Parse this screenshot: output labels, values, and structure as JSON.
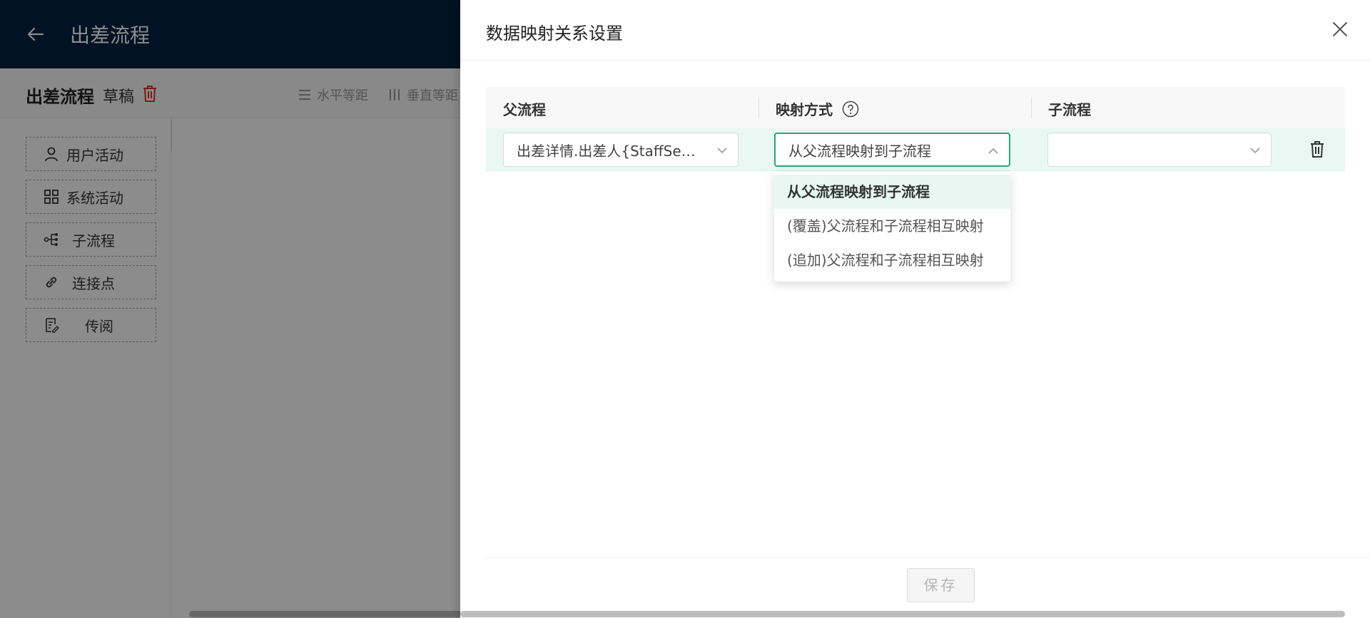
{
  "header": {
    "title": "出差流程",
    "back_icon": "arrow-left-icon"
  },
  "toolbar": {
    "flow_name": "出差流程",
    "status": "草稿",
    "delete_icon": "trash-icon",
    "delete_color": "#e0352b",
    "buttons": [
      {
        "label": "水平等距",
        "icon": "horizontal-distribute-icon"
      },
      {
        "label": "垂直等距",
        "icon": "vertical-distribute-icon"
      }
    ]
  },
  "palette": {
    "items": [
      {
        "label": "用户活动",
        "icon": "user-icon"
      },
      {
        "label": "系统活动",
        "icon": "grid-icon"
      },
      {
        "label": "子流程",
        "icon": "subprocess-icon"
      },
      {
        "label": "连接点",
        "icon": "link-icon"
      },
      {
        "label": "传阅",
        "icon": "document-icon"
      }
    ]
  },
  "drawer": {
    "title": "数据映射关系设置",
    "close_icon": "close-icon",
    "columns": {
      "parent": "父流程",
      "mode": "映射方式",
      "child": "子流程"
    },
    "row": {
      "parent_value": "出差详情.出差人{StaffSelector}",
      "mode_value": "从父流程映射到子流程",
      "child_value": "",
      "delete_icon": "trash-icon"
    },
    "mode_options": [
      "从父流程映射到子流程",
      "(覆盖)父流程和子流程相互映射",
      "(追加)父流程和子流程相互映射"
    ],
    "selected_option_index": 0,
    "save_label": "保存"
  },
  "colors": {
    "header_bg": "#002140",
    "accent": "#25a87f",
    "row_highlight": "#eaf8f3"
  }
}
